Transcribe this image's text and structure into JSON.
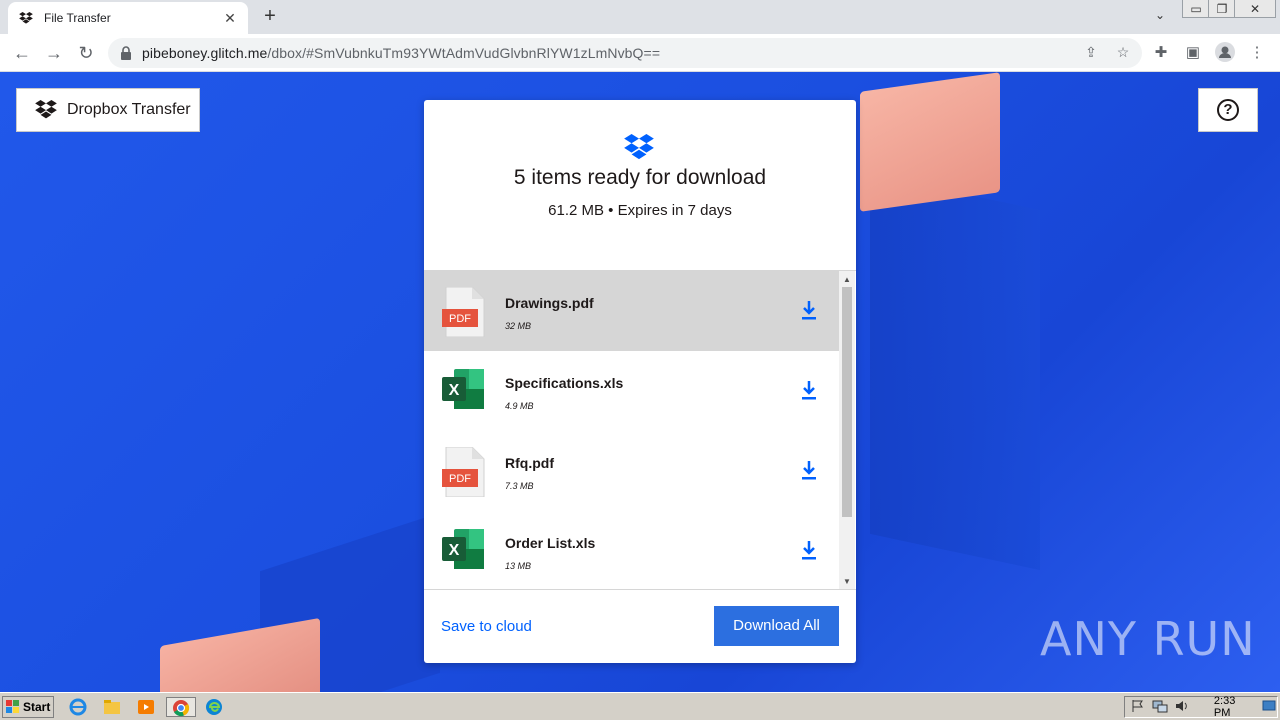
{
  "browser": {
    "tab_title": "File Transfer",
    "new_tab": "+",
    "url_host": "pibeboney.glitch.me",
    "url_path": "/dbox/#SmVubnkuTm93YWtAdmVudGlvbnRlYW1zLmNvbQ=="
  },
  "header": {
    "brand_label": "Dropbox Transfer"
  },
  "card": {
    "title": "5 items ready for download",
    "subtitle": "61.2 MB • Expires in 7 days",
    "files": [
      {
        "name": "Drawings.pdf",
        "size": "32 MB",
        "type": "pdf",
        "pdf_label": "PDF"
      },
      {
        "name": "Specifications.xls",
        "size": "4.9 MB",
        "type": "xls"
      },
      {
        "name": "Rfq.pdf",
        "size": "7.3 MB",
        "type": "pdf",
        "pdf_label": "PDF"
      },
      {
        "name": "Order List.xls",
        "size": "13 MB",
        "type": "xls"
      }
    ],
    "save_label": "Save to cloud",
    "download_all_label": "Download All"
  },
  "watermark": "ANY RUN",
  "taskbar": {
    "start_label": "Start",
    "clock": "2:33 PM"
  },
  "colors": {
    "dropbox_blue": "#0061fe",
    "background_blue": "#1f53e6",
    "excel_green": "#1d6f42",
    "pdf_red": "#e5533d"
  }
}
